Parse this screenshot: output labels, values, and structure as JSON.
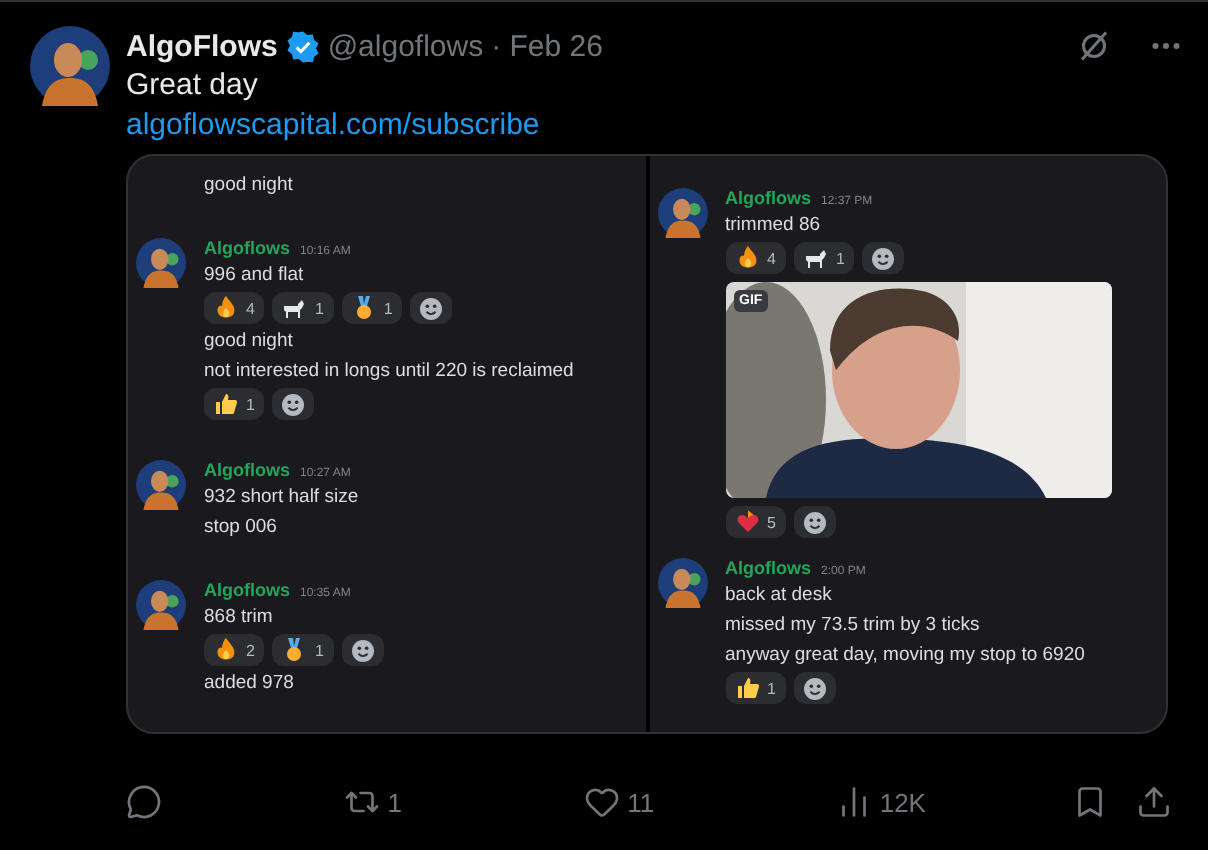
{
  "post": {
    "author": "AlgoFlows",
    "verified": true,
    "handle": "@algoflows",
    "date": "· Feb 26",
    "text": "Great day",
    "link": "algoflowscapital.com/subscribe"
  },
  "screenshot": {
    "panels": [
      {
        "groups": [
          {
            "items": [
              {
                "kind": "text",
                "text": "good night"
              }
            ]
          },
          {
            "author": "Algoflows",
            "time": "10:16 AM",
            "items": [
              {
                "kind": "text",
                "text": "996 and flat",
                "reactions": [
                  {
                    "kind": "fire",
                    "count": "4"
                  },
                  {
                    "kind": "goat",
                    "count": "1"
                  },
                  {
                    "kind": "medal",
                    "count": "1"
                  }
                ]
              },
              {
                "kind": "text",
                "text": "good night"
              },
              {
                "kind": "text",
                "text": "not interested in longs until 220 is reclaimed",
                "reactions": [
                  {
                    "kind": "thumbs",
                    "count": "1"
                  }
                ]
              }
            ]
          },
          {
            "author": "Algoflows",
            "time": "10:27 AM",
            "items": [
              {
                "kind": "text",
                "text": "932 short half size"
              },
              {
                "kind": "text",
                "text": "stop 006"
              }
            ]
          },
          {
            "author": "Algoflows",
            "time": "10:35 AM",
            "items": [
              {
                "kind": "text",
                "text": "868 trim",
                "reactions": [
                  {
                    "kind": "fire",
                    "count": "2"
                  },
                  {
                    "kind": "medal",
                    "count": "1"
                  }
                ]
              },
              {
                "kind": "text",
                "text": "added 978"
              }
            ]
          }
        ]
      },
      {
        "groups": [
          {
            "author": "Algoflows",
            "time": "12:37 PM",
            "items": [
              {
                "kind": "text",
                "text": "trimmed 86",
                "reactions": [
                  {
                    "kind": "fire",
                    "count": "4"
                  },
                  {
                    "kind": "goat",
                    "count": "1"
                  }
                ]
              },
              {
                "kind": "gif",
                "badge": "GIF",
                "reactions": [
                  {
                    "kind": "heartfire",
                    "count": "5"
                  }
                ]
              }
            ]
          },
          {
            "author": "Algoflows",
            "time": "2:00 PM",
            "items": [
              {
                "kind": "text",
                "text": "back at desk"
              },
              {
                "kind": "text",
                "text": "missed my 73.5 trim by 3 ticks"
              },
              {
                "kind": "text",
                "text": "anyway great day, moving my stop to 6920",
                "reactions": [
                  {
                    "kind": "thumbs",
                    "count": "1"
                  }
                ]
              }
            ]
          }
        ]
      }
    ]
  },
  "actions": [
    {
      "kind": "reply"
    },
    {
      "kind": "repost",
      "count": "1"
    },
    {
      "kind": "like",
      "count": "11"
    },
    {
      "kind": "views",
      "count": "12K"
    },
    {
      "kind": "bookmark"
    },
    {
      "kind": "share"
    }
  ]
}
